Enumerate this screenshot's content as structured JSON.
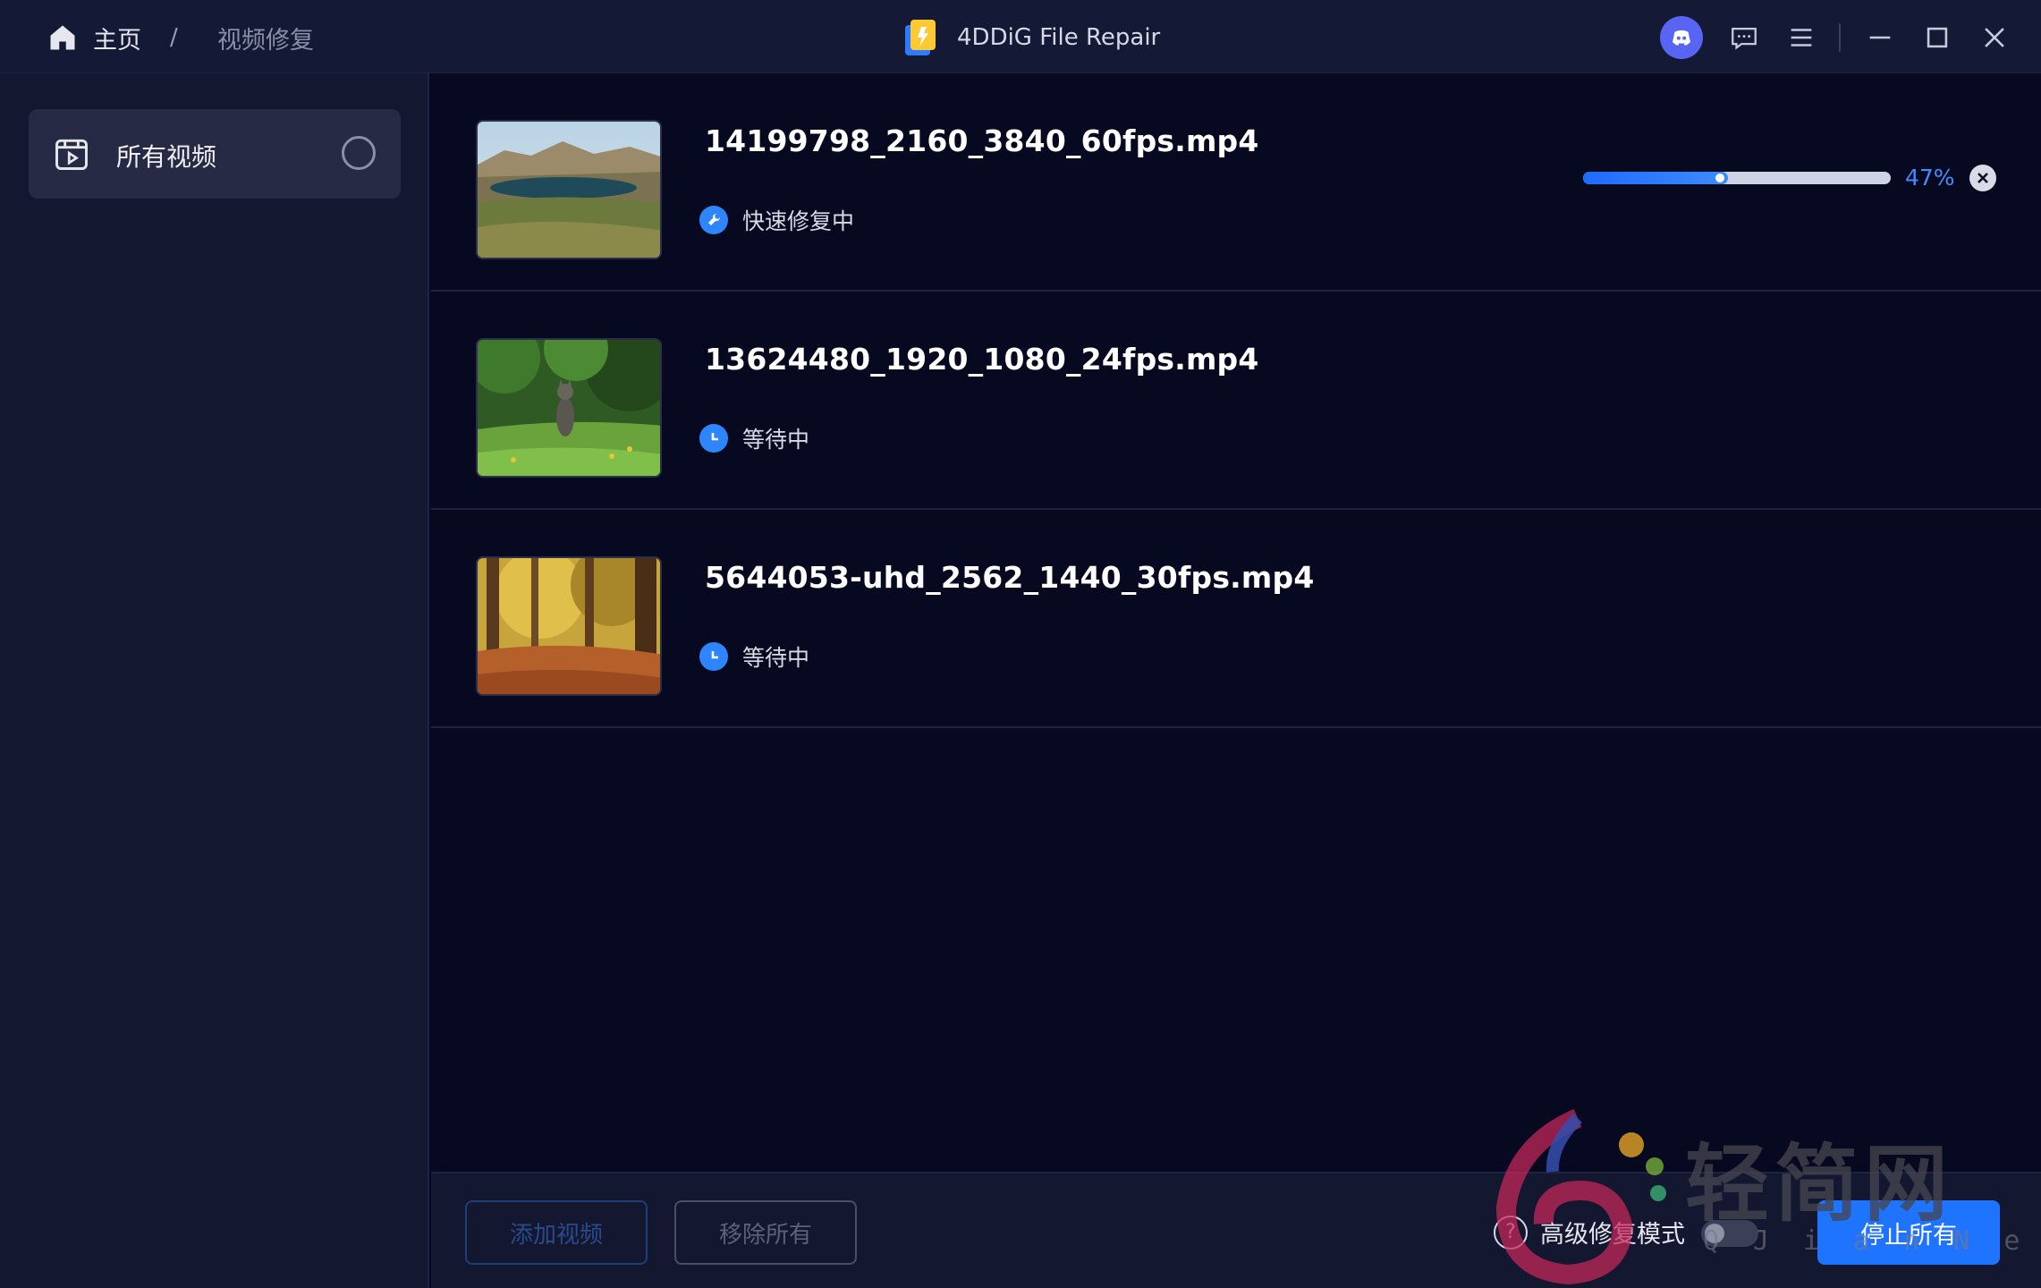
{
  "titlebar": {
    "breadcrumb": {
      "home": "主页",
      "separator": "/",
      "current": "视频修复"
    },
    "app_title": "4DDiG File Repair",
    "icons": [
      "discord-icon",
      "feedback-icon",
      "menu-icon",
      "minimize-icon",
      "maximize-icon",
      "close-icon"
    ]
  },
  "sidebar": {
    "items": [
      {
        "label": "所有视频",
        "icon": "video-folder-icon",
        "selected": false
      }
    ]
  },
  "files": [
    {
      "name": "14199798_2160_3840_60fps.mp4",
      "status": "快速修复中",
      "status_icon": "wrench-icon",
      "progress": 47,
      "progress_label": "47%",
      "thumbnail": "mountain-lake"
    },
    {
      "name": "13624480_1920_1080_24fps.mp4",
      "status": "等待中",
      "status_icon": "clock-icon",
      "thumbnail": "cat-in-grass"
    },
    {
      "name": "5644053-uhd_2562_1440_30fps.mp4",
      "status": "等待中",
      "status_icon": "clock-icon",
      "thumbnail": "autumn-forest"
    }
  ],
  "footer": {
    "add_video": "添加视频",
    "remove_all": "移除所有",
    "advanced_mode": "高级修复模式",
    "advanced_mode_enabled": false,
    "help": "?",
    "stop_all": "停止所有"
  },
  "watermark": {
    "text": "轻简网",
    "sub": "QJianNet"
  },
  "colors": {
    "accent": "#1f74ff",
    "progress_text": "#3f8cff",
    "background": "#060920",
    "sidebar": "#13172f"
  }
}
